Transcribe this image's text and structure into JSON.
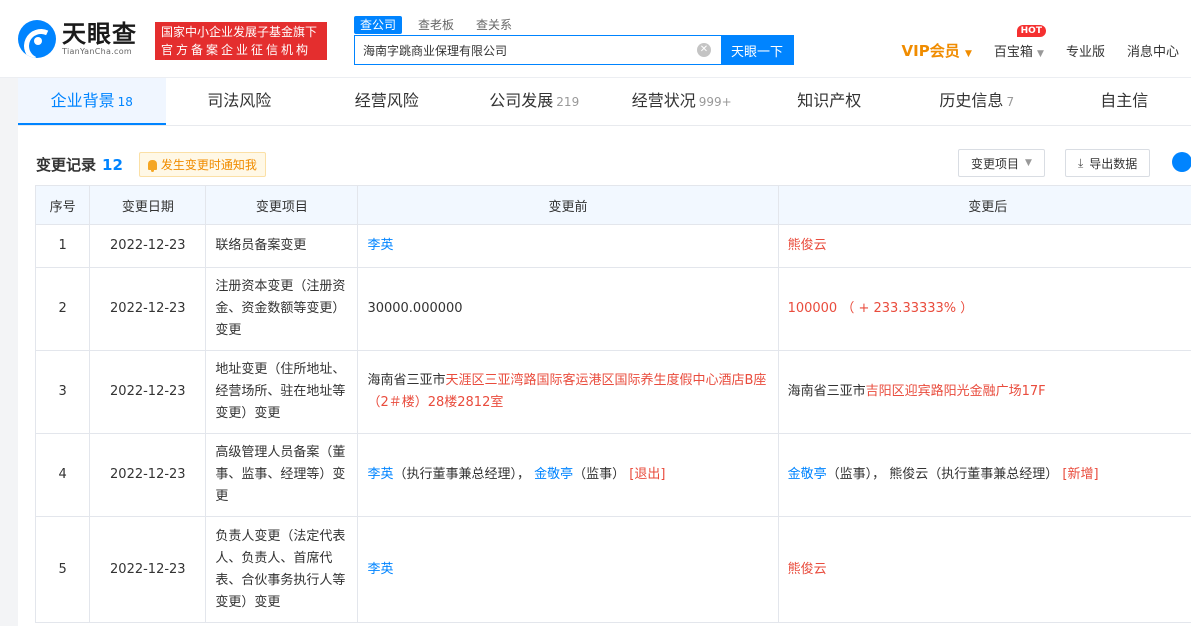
{
  "header": {
    "logo_cn": "天眼查",
    "logo_en": "TianYanCha.com",
    "badge_line1": "国家中小企业发展子基金旗下",
    "badge_line2": "官方备案企业征信机构",
    "search_tabs": [
      "查公司",
      "查老板",
      "查关系"
    ],
    "search_value": "海南字跳商业保理有限公司",
    "search_button": "天眼一下",
    "nav": {
      "vip": "VIP会员",
      "baoxiang": "百宝箱",
      "hot": "HOT",
      "pro": "专业版",
      "messages": "消息中心"
    }
  },
  "tabs": [
    {
      "label": "企业背景",
      "count": "18"
    },
    {
      "label": "司法风险",
      "count": ""
    },
    {
      "label": "经营风险",
      "count": ""
    },
    {
      "label": "公司发展",
      "count": "219"
    },
    {
      "label": "经营状况",
      "count": "999+"
    },
    {
      "label": "知识产权",
      "count": ""
    },
    {
      "label": "历史信息",
      "count": "7"
    },
    {
      "label": "自主信",
      "count": ""
    }
  ],
  "section": {
    "title": "变更记录",
    "count": "12",
    "notify": "发生变更时通知我",
    "filter": "变更项目",
    "export": "导出数据"
  },
  "table": {
    "headers": [
      "序号",
      "变更日期",
      "变更项目",
      "变更前",
      "变更后"
    ],
    "rows": [
      {
        "no": "1",
        "date": "2022-12-23",
        "item": "联络员备案变更",
        "before": "李英",
        "after": "熊俊云"
      },
      {
        "no": "2",
        "date": "2022-12-23",
        "item": "注册资本变更（注册资金、资金数额等变更）变更",
        "before": "30000.000000",
        "after": "100000 （ + 233.33333% ）"
      },
      {
        "no": "3",
        "date": "2022-12-23",
        "item": "地址变更（住所地址、经营场所、驻在地址等变更）变更",
        "before_prefix": "海南省三亚市",
        "before_hl": "天涯区三亚湾路国际客运港区国际养生度假中心酒店B座（2＃楼）28楼2812室",
        "after_prefix": "海南省三亚市",
        "after_hl": "吉阳区迎宾路阳光金融广场17F"
      },
      {
        "no": "4",
        "date": "2022-12-23",
        "item": "高级管理人员备案（董事、监事、经理等）变更",
        "before_p1": "李英",
        "before_p1_role": "（执行董事兼总经理），",
        "before_p2": "金敬亭",
        "before_p2_role": "（监事）",
        "before_tag": "[退出]",
        "after_p1": "金敬亭",
        "after_p1_role": "（监事），",
        "after_p2_text": "熊俊云（执行董事兼总经理）",
        "after_tag": "[新增]"
      },
      {
        "no": "5",
        "date": "2022-12-23",
        "item": "负责人变更（法定代表人、负责人、首席代表、合伙事务执行人等变更）变更",
        "before": "李英",
        "after": "熊俊云"
      }
    ]
  }
}
